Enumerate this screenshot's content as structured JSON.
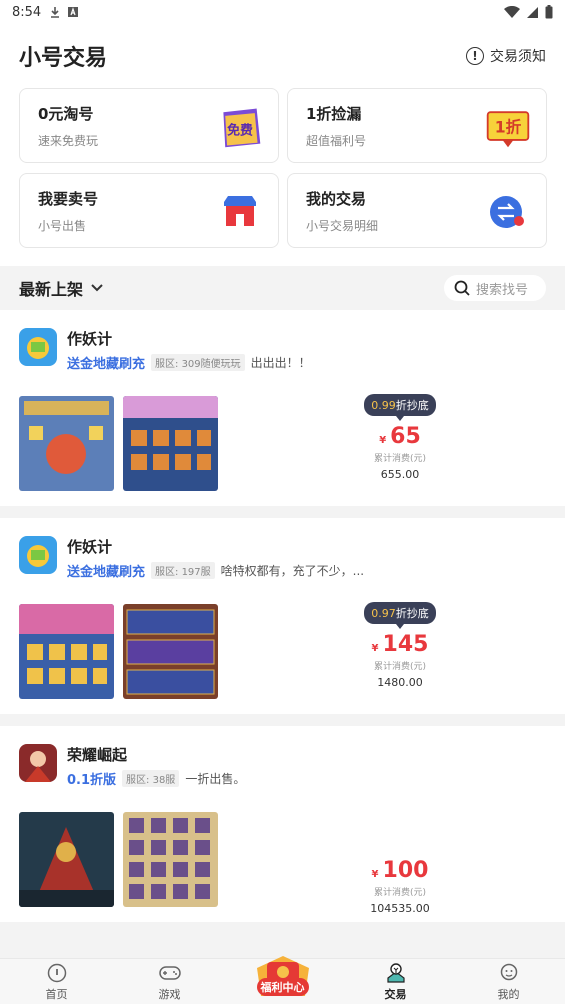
{
  "status": {
    "time": "8:54"
  },
  "header": {
    "title": "小号交易",
    "notice_label": "交易须知"
  },
  "tiles": [
    {
      "title": "0元淘号",
      "sub": "速来免费玩",
      "icon": "free-icon"
    },
    {
      "title": "1折捡漏",
      "sub": "超值福利号",
      "icon": "one-discount-icon"
    },
    {
      "title": "我要卖号",
      "sub": "小号出售",
      "icon": "shop-icon"
    },
    {
      "title": "我的交易",
      "sub": "小号交易明细",
      "icon": "exchange-icon"
    }
  ],
  "section": {
    "title": "最新上架",
    "search_placeholder": "搜索找号"
  },
  "listings": [
    {
      "name": "作妖计",
      "tag": "送金地藏刷充",
      "server": "服区: 309随便玩玩",
      "desc": "出出出！！",
      "discount_num": "0.99",
      "discount_suffix": "折抄底",
      "price": "65",
      "spent_label": "累计消费(元)",
      "spent": "655.00"
    },
    {
      "name": "作妖计",
      "tag": "送金地藏刷充",
      "server": "服区: 197服",
      "desc": "啥特权都有，充了不少，...",
      "discount_num": "0.97",
      "discount_suffix": "折抄底",
      "price": "145",
      "spent_label": "累计消费(元)",
      "spent": "1480.00"
    },
    {
      "name": "荣耀崛起",
      "tag": "0.1折版",
      "server": "服区: 38服",
      "desc": "一折出售。",
      "discount_num": "",
      "discount_suffix": "",
      "price": "100",
      "spent_label": "累计消费(元)",
      "spent": "104535.00"
    }
  ],
  "currency": "¥",
  "nav": {
    "home": "首页",
    "games": "游戏",
    "welfare": "福利中心",
    "trade": "交易",
    "mine": "我的"
  },
  "tile_badges": {
    "free": "免费",
    "one": "1折"
  }
}
